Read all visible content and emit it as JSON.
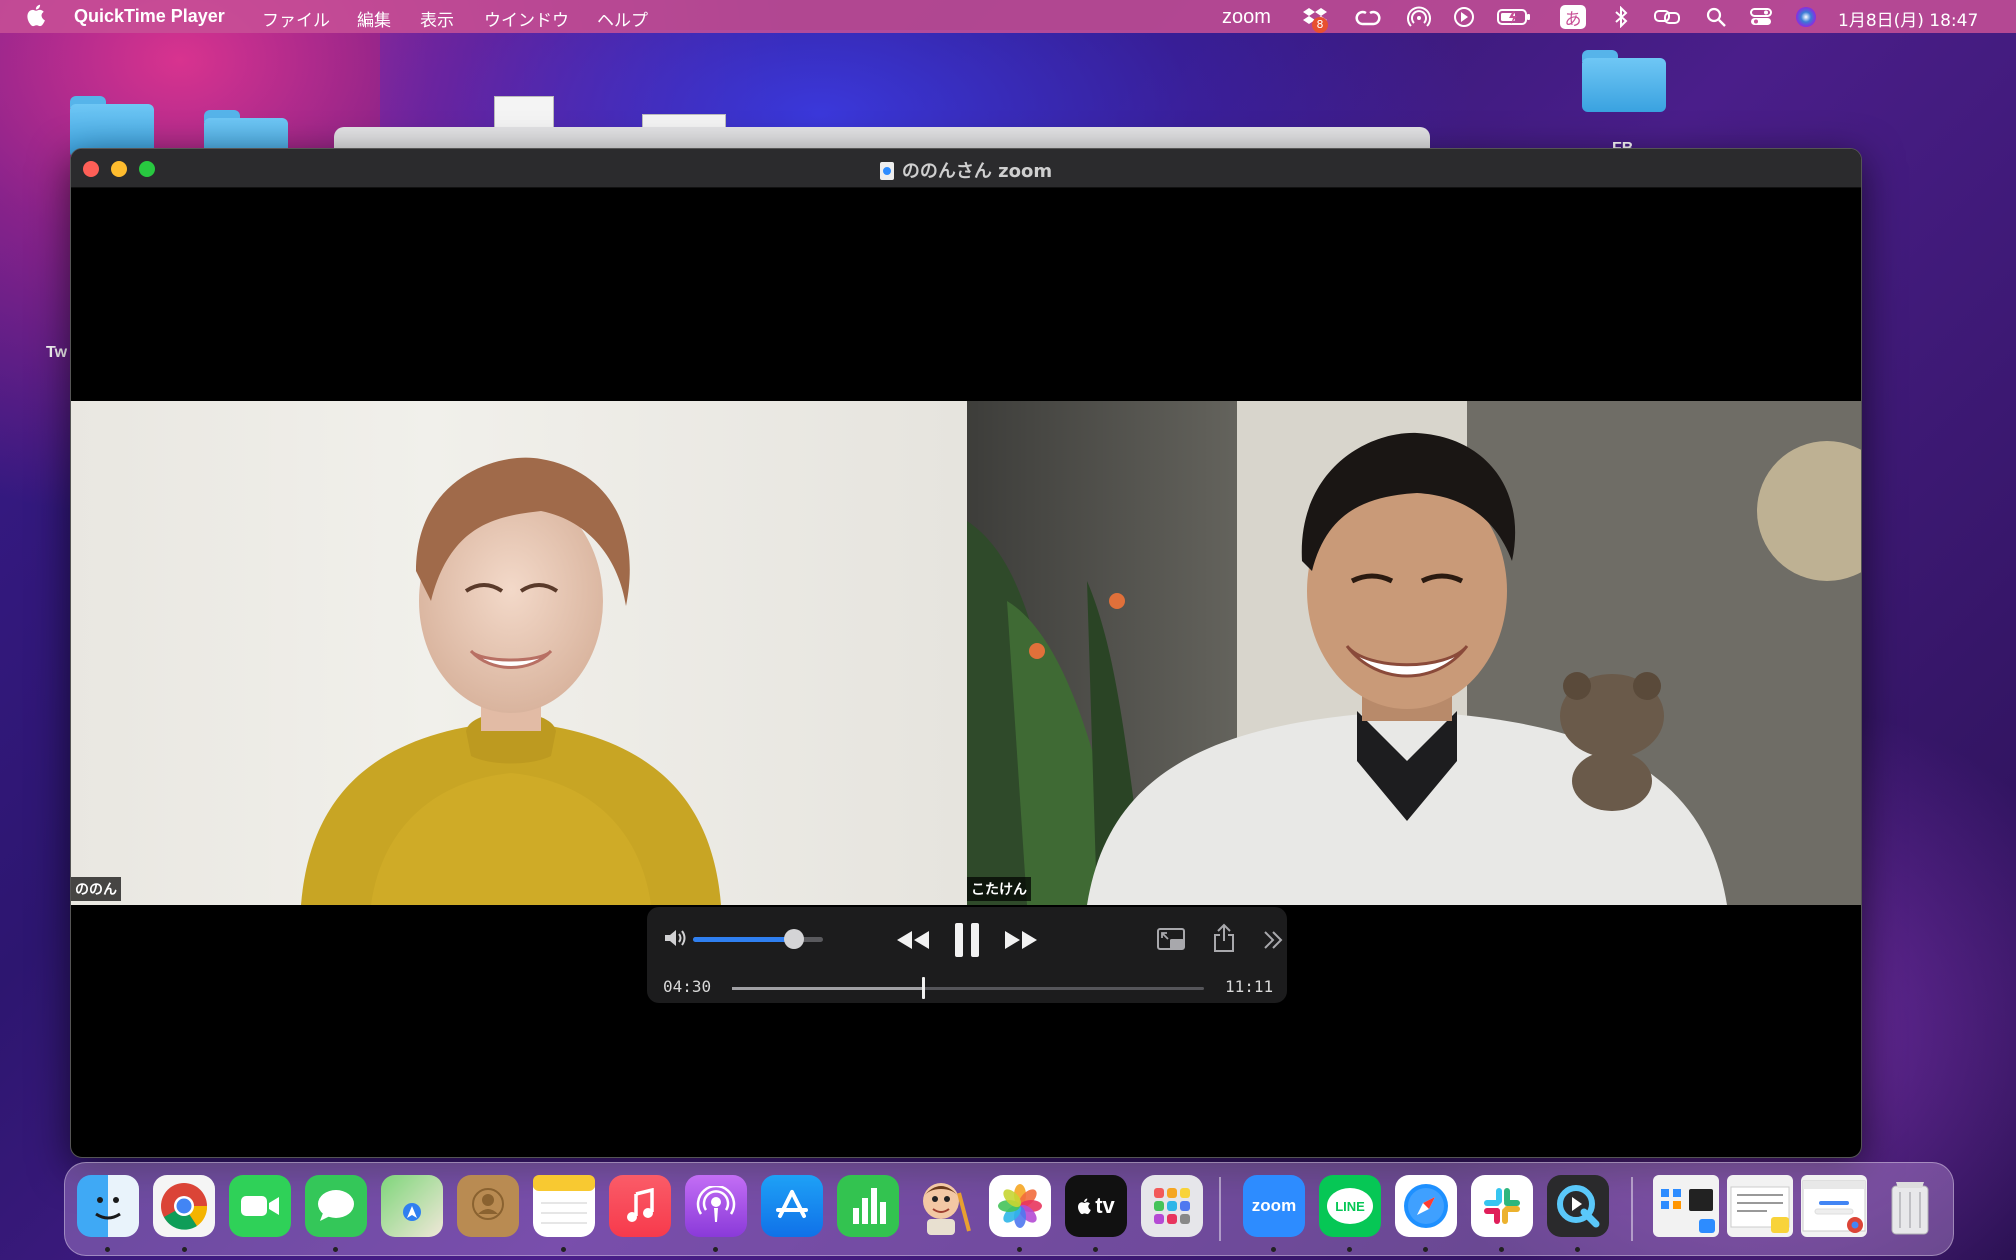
{
  "menubar": {
    "app_name": "QuickTime Player",
    "menus": [
      "ファイル",
      "編集",
      "表示",
      "ウインドウ",
      "ヘルプ"
    ],
    "zoom_label": "zoom",
    "dropbox_badge": "8",
    "input_method": "あ",
    "clock": "1月8日(月)  18:47"
  },
  "desktop": {
    "labels": {
      "left": "Tw",
      "right": "FB"
    }
  },
  "window": {
    "title": "ののんさん zoom",
    "participants": [
      {
        "name": "ののん"
      },
      {
        "name": "こたけん"
      }
    ],
    "controls": {
      "elapsed": "04:30",
      "total": "11:11",
      "volume_fraction": 0.78,
      "progress_fraction": 0.405
    }
  },
  "dock": {
    "zoom_label": "zoom",
    "line_label": "LINE",
    "tv_label": "tv"
  }
}
